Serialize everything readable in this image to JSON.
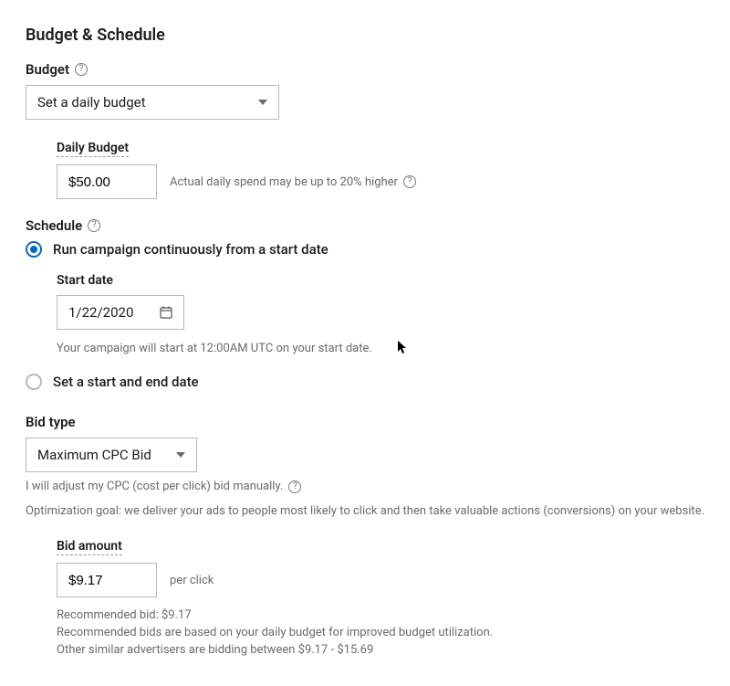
{
  "section": {
    "title": "Budget & Schedule"
  },
  "budget": {
    "label": "Budget",
    "select_value": "Set a daily budget",
    "daily_label": "Daily Budget",
    "daily_value": "$50.00",
    "daily_hint": "Actual daily spend may be up to 20% higher"
  },
  "schedule": {
    "label": "Schedule",
    "option1": "Run campaign continuously from a start date",
    "option2": "Set a start and end date",
    "start_date_label": "Start date",
    "start_date_value": "1/22/2020",
    "start_date_hint": "Your campaign will start at 12:00AM UTC on your start date."
  },
  "bid": {
    "label": "Bid type",
    "select_value": "Maximum CPC Bid",
    "desc_line1": "I will adjust my CPC (cost per click) bid manually.",
    "desc_line2": "Optimization goal: we deliver your ads to people most likely to click and then take valuable actions (conversions) on your website.",
    "amount_label": "Bid amount",
    "amount_value": "$9.17",
    "amount_unit": "per click",
    "reco1": "Recommended bid: $9.17",
    "reco2": "Recommended bids are based on your daily budget for improved budget utilization.",
    "reco3": "Other similar advertisers are bidding between $9.17 - $15.69"
  }
}
